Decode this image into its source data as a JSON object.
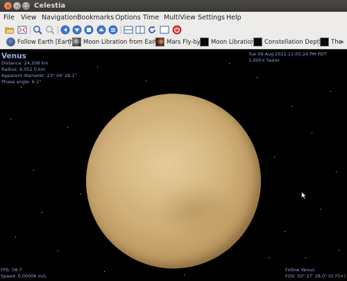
{
  "window": {
    "title": "Celestia"
  },
  "menu": [
    "File",
    "View",
    "Navigation",
    "Bookmarks",
    "Options",
    "Time",
    "MultiView",
    "Settings",
    "Help"
  ],
  "bookmarks": {
    "items": [
      {
        "label": "Follow Earth [Earth]"
      },
      {
        "label": "Moon Libration from Earth"
      },
      {
        "label": "Mars Fly-by"
      },
      {
        "label": "Moon Libration"
      },
      {
        "label": "Constellation Depth"
      },
      {
        "label": "The"
      }
    ],
    "overflow": "»"
  },
  "hud": {
    "object_name": "Venus",
    "distance": "Distance: 24,208 km",
    "radius": "Radius: 6,052.0 km",
    "apparent_diameter": "Apparent diameter: 23° 04' 26.1\"",
    "phase_angle": "Phase angle: 6.1°",
    "datetime": "Tue 09 Aug 2011 11:05:24 PM PDT",
    "time_rate": "1,000× faster",
    "fps": "FPS: 58.7",
    "speed": "Speed: 0.00006 m/s",
    "follow": "Follow Venus",
    "fov": "FOV: 30° 27' 28.0\" (0.70×)"
  }
}
